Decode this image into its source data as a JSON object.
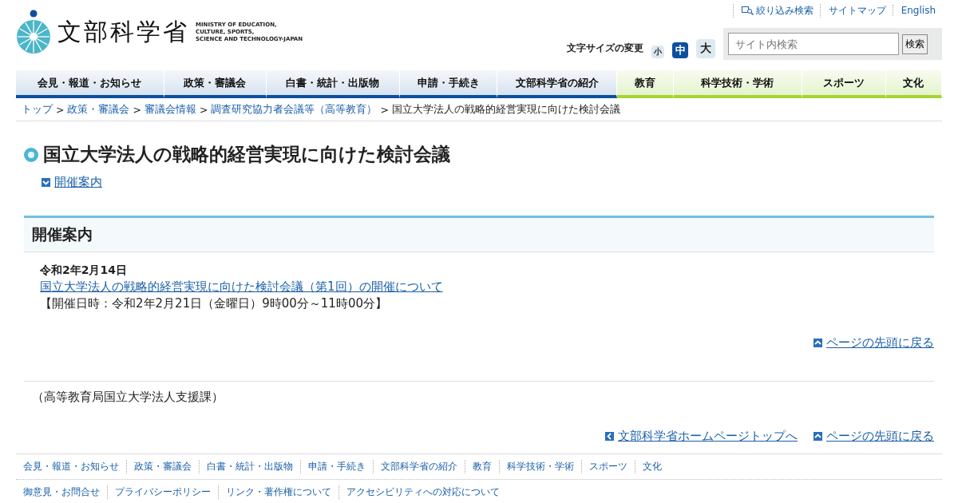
{
  "logo": {
    "name": "文部科学省",
    "english": [
      "MINISTRY OF EDUCATION,",
      "CULTURE, SPORTS,",
      "SCIENCE AND TECHNOLOGY-JAPAN"
    ]
  },
  "utility_links": [
    {
      "label": "絞り込み検索",
      "kind": "search"
    },
    {
      "label": "サイトマップ",
      "kind": "plain"
    },
    {
      "label": "English",
      "kind": "plain"
    }
  ],
  "font_size": {
    "label": "文字サイズの変更",
    "options": [
      {
        "label": "小",
        "selected": false,
        "kind": "small"
      },
      {
        "label": "中",
        "selected": true,
        "kind": "medium"
      },
      {
        "label": "大",
        "selected": false,
        "kind": "large"
      }
    ]
  },
  "search": {
    "placeholder": "サイト内検索",
    "button": "検索"
  },
  "nav": [
    {
      "label": "会見・報道・お知らせ",
      "kind": "blue"
    },
    {
      "label": "政策・審議会",
      "kind": "blue"
    },
    {
      "label": "白書・統計・出版物",
      "kind": "blue"
    },
    {
      "label": "申請・手続き",
      "kind": "blue"
    },
    {
      "label": "文部科学省の紹介",
      "kind": "blue"
    },
    {
      "label": "教育",
      "kind": "green"
    },
    {
      "label": "科学技術・学術",
      "kind": "green"
    },
    {
      "label": "スポーツ",
      "kind": "green"
    },
    {
      "label": "文化",
      "kind": "green"
    }
  ],
  "breadcrumb": {
    "separator": ">",
    "links": [
      "トップ",
      "政策・審議会",
      "審議会情報",
      "調査研究協力者会議等（高等教育）"
    ],
    "current": "国立大学法人の戦略的経営実現に向けた検討会議"
  },
  "page_title": "国立大学法人の戦略的経営実現に向けた検討会議",
  "toc": [
    "開催案内"
  ],
  "section": {
    "heading": "開催案内",
    "date": "令和2年2月14日",
    "link": "国立大学法人の戦略的経営実現に向けた検討会議（第1回）の開催について",
    "detail": "【開催日時：令和2年2月21日（金曜日）9時00分～11時00分】"
  },
  "back_to_top": "ページの先頭に戻る",
  "department": "（高等教育局国立大学法人支援課）",
  "bottom_links": [
    {
      "label": "文部科学省ホームページトップへ",
      "kind": "home"
    },
    {
      "label": "ページの先頭に戻る",
      "kind": "top"
    }
  ],
  "footer_nav": [
    "会見・報道・お知らせ",
    "政策・審議会",
    "白書・統計・出版物",
    "申請・手続き",
    "文部科学省の紹介",
    "教育",
    "科学技術・学術",
    "スポーツ",
    "文化"
  ],
  "footer_links": [
    "御意見・お問合せ",
    "プライバシーポリシー",
    "リンク・著作権について",
    "アクセシビリティへの対応について"
  ]
}
